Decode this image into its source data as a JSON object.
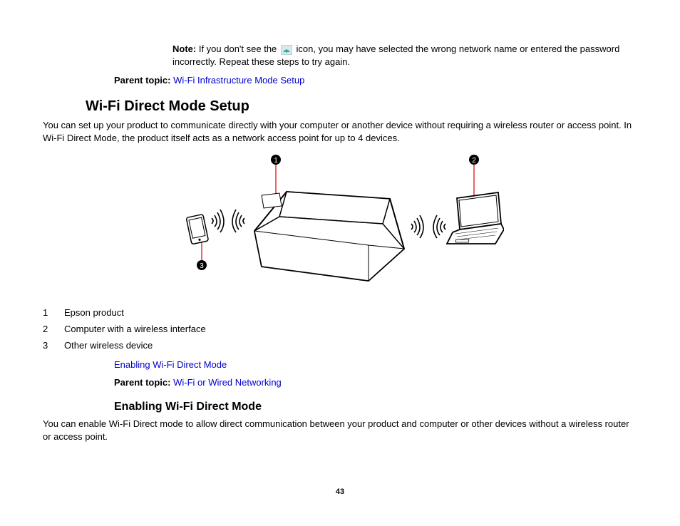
{
  "note": {
    "label": "Note:",
    "text_before": " If you don't see the ",
    "text_after": " icon, you may have selected the wrong network name or entered the password incorrectly. Repeat these steps to try again."
  },
  "parent_topic_1": {
    "label": "Parent topic:",
    "link": "Wi-Fi Infrastructure Mode Setup"
  },
  "section": {
    "title": "Wi-Fi Direct Mode Setup",
    "intro": "You can set up your product to communicate directly with your computer or another device without requiring a wireless router or access point. In Wi-Fi Direct Mode, the product itself acts as a network access point for up to 4 devices."
  },
  "callouts": {
    "c1": "1",
    "c2": "2",
    "c3": "3"
  },
  "legend": [
    {
      "num": "1",
      "text": "Epson product"
    },
    {
      "num": "2",
      "text": "Computer with a wireless interface"
    },
    {
      "num": "3",
      "text": "Other wireless device"
    }
  ],
  "sublink": "Enabling Wi-Fi Direct Mode",
  "parent_topic_2": {
    "label": "Parent topic:",
    "link": "Wi-Fi or Wired Networking"
  },
  "subsection": {
    "title": "Enabling Wi-Fi Direct Mode",
    "intro": "You can enable Wi-Fi Direct mode to allow direct communication between your product and computer or other devices without a wireless router or access point."
  },
  "page_number": "43"
}
